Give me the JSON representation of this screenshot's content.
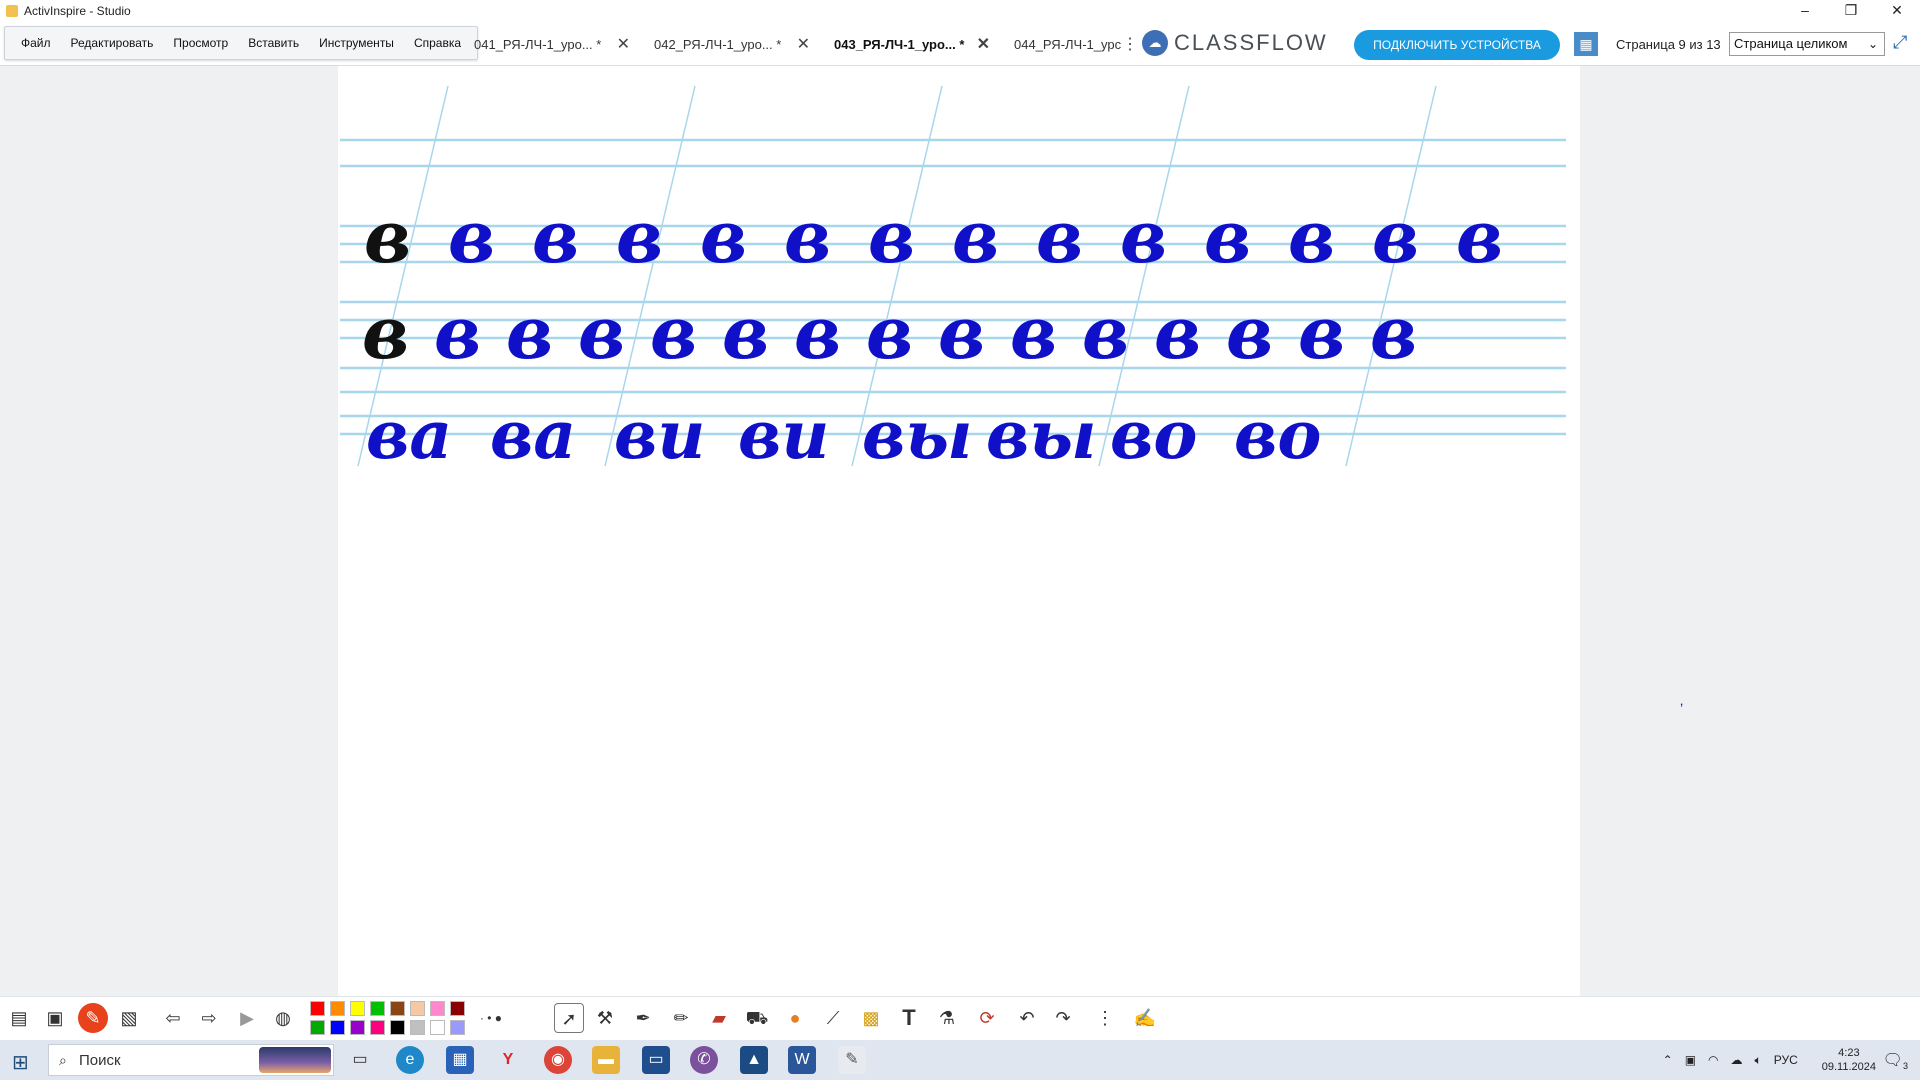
{
  "window": {
    "title": "ActivInspire - Studio",
    "controls": [
      "–",
      "❐",
      "✕"
    ]
  },
  "menu": {
    "items": [
      "Файл",
      "Редактировать",
      "Просмотр",
      "Вставить",
      "Инструменты",
      "Справка"
    ]
  },
  "tabs": [
    {
      "label": "041_РЯ-ЛЧ-1_уро... *"
    },
    {
      "label": "042_РЯ-ЛЧ-1_уро... *"
    },
    {
      "label": "043_РЯ-ЛЧ-1_уро... *"
    },
    {
      "label": "044_РЯ-ЛЧ-1_урс"
    }
  ],
  "classflow": {
    "logo_text": "CLASSFLOW",
    "connect_button": "ПОДКЛЮЧИТЬ УСТРОЙСТВА"
  },
  "pager": {
    "label": "Страница 9 из 13",
    "zoom_value": "Страница целиком"
  },
  "copybook": {
    "row1": [
      "в",
      "в",
      "в",
      "в",
      "в",
      "в",
      "в",
      "в",
      "в",
      "в",
      "в",
      "в",
      "в",
      "в"
    ],
    "row2": [
      "в",
      "в",
      "в",
      "в",
      "в",
      "в",
      "в",
      "в",
      "в",
      "в",
      "в",
      "в",
      "в",
      "в",
      "в"
    ],
    "row3": [
      "ва",
      "ва",
      "ви",
      "ви",
      "вы",
      "вы",
      "во",
      "во"
    ],
    "ink_color": "#1010c8",
    "sample_color": "#111111",
    "ruling_color": "#a8d6ec"
  },
  "toolbar": {
    "colors": [
      "#ff0000",
      "#ff8c00",
      "#ffff00",
      "#00c000",
      "#8b4513",
      "#f5c9a6",
      "#ff88cc",
      "#8b0000",
      "#00aa00",
      "#0000ff",
      "#9900cc",
      "#ff0080",
      "#000000",
      "#c0c0c0",
      "#ffffff",
      "#9999ff"
    ]
  },
  "taskbar": {
    "search_placeholder": "Поиск",
    "lang": "РУС",
    "time": "4:23",
    "date": "09.11.2024",
    "notifications": "3"
  }
}
